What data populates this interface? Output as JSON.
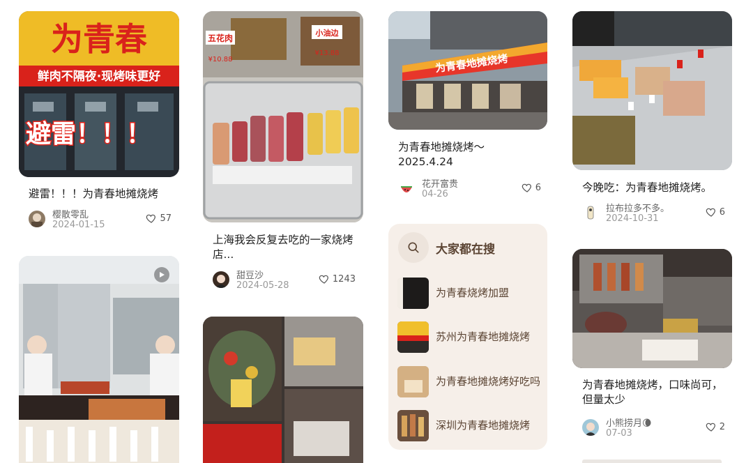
{
  "feed": {
    "cards": [
      {
        "title": "避雷！！！为青春地摊烧烤",
        "author": "樱散零乱",
        "date": "2024-01-15",
        "likes": "57"
      },
      {
        "title": "上海我会反复去吃的一家烧烤店...",
        "author": "甜豆沙",
        "date": "2024-05-28",
        "likes": "1243"
      },
      {
        "title": "为青春地摊烧烤～2025.4.24",
        "author": "花开富贵",
        "date": "04-26",
        "likes": "6"
      },
      {
        "title": "今晚吃：为青春地摊烧烤。",
        "author": "拉布拉多不多。",
        "date": "2024-10-31",
        "likes": "6"
      },
      {
        "title": "为青春地摊烧烤，口味尚可，但量太少",
        "author": "小熊捞月🌘",
        "date": "07-03",
        "likes": "2"
      }
    ],
    "image_text": {
      "sign_brand": "为青春",
      "sign_slogan": "鲜肉不隔夜·现烤味更好",
      "overlay_warning": "避雷！！！",
      "tag_pork": "五花肉",
      "tag_price_1": "¥10.88",
      "tag_oil": "小油边",
      "tag_price_2": "¥13.88",
      "storefront_sign": "为青春地摊烧烤"
    }
  },
  "search_block": {
    "heading": "大家都在搜",
    "items": [
      {
        "label": "为青春烧烤加盟"
      },
      {
        "label": "苏州为青春地摊烧烤"
      },
      {
        "label": "为青春地摊烧烤好吃吗"
      },
      {
        "label": "深圳为青春地摊烧烤"
      }
    ]
  },
  "colors": {
    "sign_red": "#d9221b",
    "search_bg": "#f6efe9",
    "search_text": "#5b4433"
  }
}
